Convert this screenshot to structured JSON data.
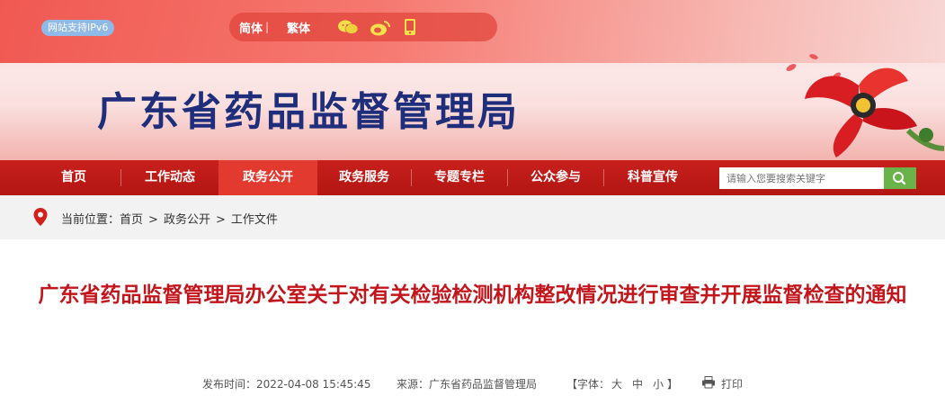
{
  "header": {
    "ipv6_badge": "网站支持IPv6",
    "lang_simplified": "简体",
    "lang_divider": "|",
    "lang_traditional": "繁体",
    "site_title": "广东省药品监督管理局"
  },
  "nav": {
    "items": [
      "首页",
      "工作动态",
      "政务公开",
      "政务服务",
      "专题专栏",
      "公众参与",
      "科普宣传"
    ],
    "active_index": 2
  },
  "search": {
    "placeholder": "请输入您要搜索关键字"
  },
  "breadcrumb": {
    "prefix": "当前位置：",
    "items": [
      "首页",
      "政务公开",
      "工作文件"
    ],
    "separator": ">"
  },
  "article": {
    "title": "广东省药品监督管理局办公室关于对有关检验检测机构整改情况进行审查并开展监督检查的通知",
    "publish_time": "发布时间：2022-04-08 15:45:45",
    "source": "来源：广东省药品监督管理局",
    "font_open": "【字体：",
    "font_large": "大",
    "font_medium": "中",
    "font_small": "小",
    "font_close": "】",
    "print": "打印"
  },
  "colors": {
    "nav_red": "#b31612",
    "active_red": "#e23a2f",
    "title_red": "#c3161c",
    "site_title_blue": "#1f2e7a"
  }
}
